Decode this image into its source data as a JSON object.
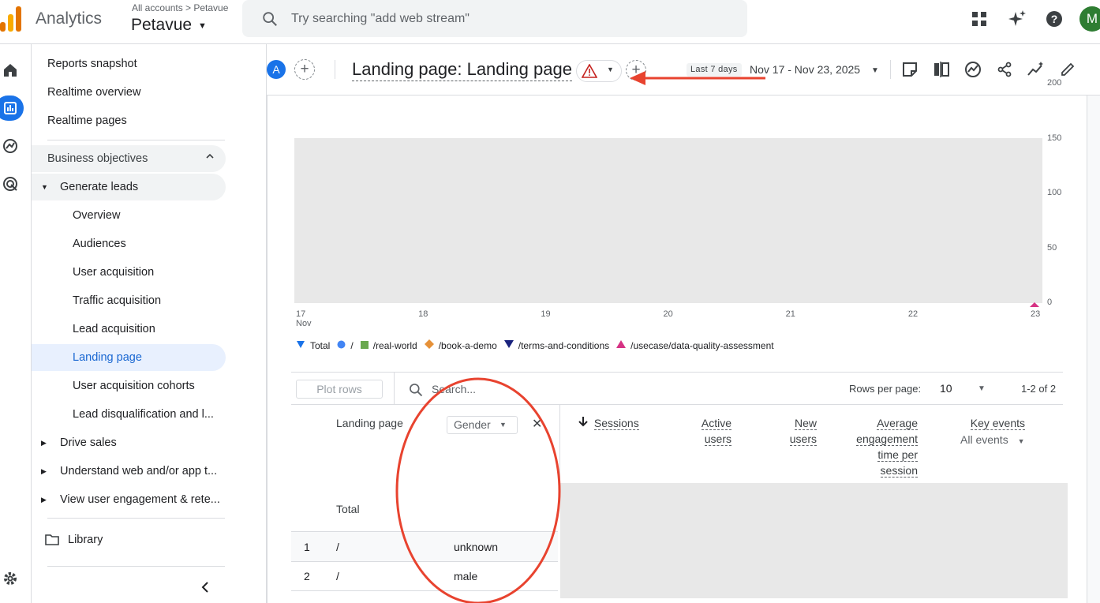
{
  "app": {
    "name": "Analytics",
    "account_path": "All accounts > Petavue",
    "account_name": "Petavue",
    "search_placeholder": "Try searching \"add web stream\"",
    "avatar_initial": "M"
  },
  "nav": {
    "items": [
      {
        "label": "Reports snapshot"
      },
      {
        "label": "Realtime overview"
      },
      {
        "label": "Realtime pages"
      }
    ],
    "section": "Business objectives",
    "group": "Generate leads",
    "sub_items": [
      {
        "label": "Overview"
      },
      {
        "label": "Audiences"
      },
      {
        "label": "User acquisition"
      },
      {
        "label": "Traffic acquisition"
      },
      {
        "label": "Lead acquisition"
      },
      {
        "label": "Landing page",
        "selected": true
      },
      {
        "label": "User acquisition cohorts"
      },
      {
        "label": "Lead disqualification and l..."
      }
    ],
    "collapsed_groups": [
      {
        "label": "Drive sales"
      },
      {
        "label": "Understand web and/or app t..."
      },
      {
        "label": "View user engagement & rete..."
      }
    ],
    "library": "Library"
  },
  "header": {
    "segment_initial": "A",
    "title": "Landing page: Landing page",
    "date_tag": "Last 7 days",
    "date_range": "Nov 17 - Nov 23, 2025"
  },
  "chart_data": {
    "type": "line",
    "x": [
      "17\nNov",
      "18",
      "19",
      "20",
      "21",
      "22",
      "23"
    ],
    "y_ticks": [
      "0",
      "50",
      "100",
      "150",
      "200"
    ],
    "ylim": [
      0,
      200
    ],
    "legend": [
      {
        "name": "Total",
        "marker": "drop",
        "color": "#1a73e8"
      },
      {
        "name": "/",
        "marker": "circle",
        "color": "#4285f4"
      },
      {
        "name": "/real-world",
        "marker": "square",
        "color": "#6aa84f"
      },
      {
        "name": "/book-a-demo",
        "marker": "diamond",
        "color": "#e69138"
      },
      {
        "name": "/terms-and-conditions",
        "marker": "triangle-down",
        "color": "#1a237e"
      },
      {
        "name": "/usecase/data-quality-assessment",
        "marker": "triangle-up",
        "color": "#d63384"
      }
    ],
    "x_tick_first": "17",
    "x_tick_first_sub": "Nov",
    "x_ticks_rest": [
      "18",
      "19",
      "20",
      "21",
      "22",
      "23"
    ]
  },
  "table": {
    "plot_rows": "Plot rows",
    "search_placeholder": "Search...",
    "rows_per_page_label": "Rows per page:",
    "rows_per_page": "10",
    "count": "1-2 of 2",
    "dimension": "Landing page",
    "secondary_dimension": "Gender",
    "total_label": "Total",
    "columns": {
      "sessions": "Sessions",
      "active_1": "Active",
      "active_2": "users",
      "new_1": "New",
      "new_2": "users",
      "avg_1": "Average",
      "avg_2": "engagement",
      "avg_3": "time per",
      "avg_4": "session",
      "key": "Key events",
      "key_filter": "All events"
    },
    "rows": [
      {
        "index": "1",
        "landing_page": "/",
        "gender": "unknown"
      },
      {
        "index": "2",
        "landing_page": "/",
        "gender": "male"
      }
    ]
  },
  "colors": {
    "accent": "#1a73e8",
    "annotation": "#e8432f"
  }
}
